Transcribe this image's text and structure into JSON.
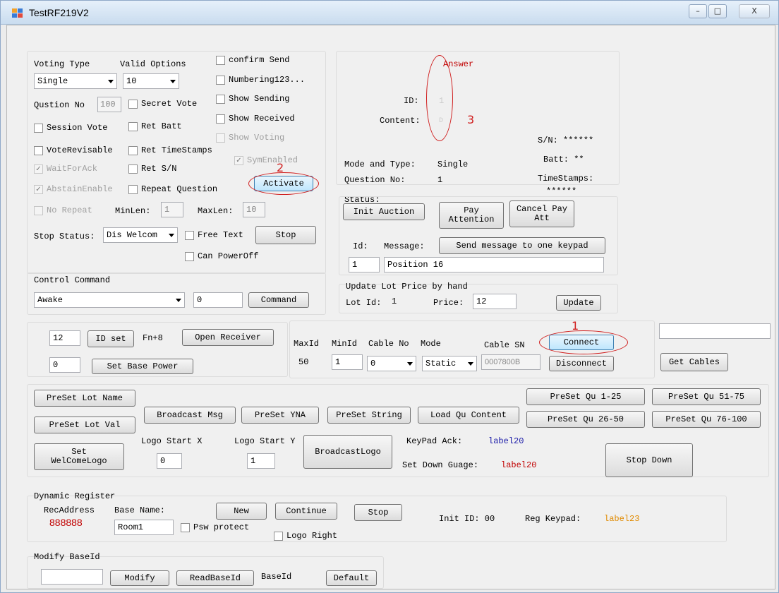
{
  "window": {
    "title": "TestRF219V2",
    "controls": [
      "–",
      "□",
      "X"
    ]
  },
  "voting": {
    "voting_type_label": "Voting Type",
    "voting_type_value": "Single",
    "valid_options_label": "Valid Options",
    "valid_options_value": "10",
    "confirm_send": "confirm Send",
    "numbering": "Numbering123...",
    "show_sending": "Show Sending",
    "show_received": "Show Received",
    "show_voting": "Show Voting",
    "qustion_no_label": "Qustion No",
    "qustion_no_value": "100",
    "secret_vote": "Secret Vote",
    "session_vote": "Session Vote",
    "ret_batt": "Ret Batt",
    "vote_revisable": "VoteRevisable",
    "ret_timestamps": "Ret TimeStamps",
    "sym_enabled": "SymEnabled",
    "wait_for_ack": "WaitForAck",
    "ret_sn": "Ret S/N",
    "abstain_enable": "AbstainEnable",
    "repeat_question": "Repeat Question",
    "activate": "Activate",
    "no_repeat": "No Repeat",
    "minlen_label": "MinLen:",
    "minlen_value": "1",
    "maxlen_label": "MaxLen:",
    "maxlen_value": "10",
    "stop_status_label": "Stop Status:",
    "stop_status_value": "Dis Welcom",
    "free_text": "Free Text",
    "stop": "Stop",
    "can_poweroff": "Can PowerOff"
  },
  "control": {
    "label": "Control Command",
    "combo_value": "Awake",
    "param_value": "0",
    "command_button": "Command"
  },
  "answer": {
    "answer_label": "Answer",
    "id_label": "ID:",
    "id_value": "1",
    "content_label": "Content:",
    "content_value": "D",
    "sn": "S/N: ******",
    "mode_label": "Mode and Type:",
    "mode_value": "Single",
    "batt": "Batt: **",
    "question_no_label": "Question No:",
    "question_no_value": "1",
    "timestamps_label": "TimeStamps:",
    "timestamps_value": "******",
    "status_label": "Status:"
  },
  "auction": {
    "init_auction": "Init Auction",
    "pay_attention": "Pay Attention",
    "cancel_pay_att": "Cancel Pay Att",
    "id_label": "Id:",
    "message_label": "Message:",
    "send_message": "Send message to one keypad",
    "id_value": "1",
    "message_value": "Position 16"
  },
  "update_lot": {
    "label": "Update Lot Price by hand",
    "lot_id_label": "Lot Id:",
    "lot_id_value": "1",
    "price_label": "Price:",
    "price_value": "12",
    "update_button": "Update"
  },
  "receiver": {
    "id_value": "12",
    "id_set": "ID set",
    "fn8": "Fn+8",
    "open_receiver": "Open Receiver",
    "power_value": "0",
    "set_base_power": "Set Base Power"
  },
  "cable": {
    "maxid_label": "MaxId",
    "minid_label": "MinId",
    "cable_no_label": "Cable No",
    "mode_label": "Mode",
    "cable_sn_label": "Cable SN",
    "maxid_value": "50",
    "minid_value": "1",
    "cable_no_value": "0",
    "mode_value": "Static",
    "cable_sn_value": "0007800B",
    "connect": "Connect",
    "disconnect": "Disconnect",
    "get_cables": "Get Cables",
    "top_field_value": ""
  },
  "preset": {
    "preset_lot_name": "PreSet Lot Name",
    "preset_lot_val": "PreSet Lot Val",
    "broadcast_msg": "Broadcast Msg",
    "preset_yna": "PreSet YNA",
    "preset_string": "PreSet String",
    "load_qu_content": "Load Qu Content",
    "preset_qu_1_25": "PreSet Qu 1-25",
    "preset_qu_26_50": "PreSet Qu 26-50",
    "preset_qu_51_75": "PreSet Qu 51-75",
    "preset_qu_76_100": "PreSet Qu 76-100",
    "set_welcome_logo": "Set WelComeLogo",
    "logo_start_x_label": "Logo Start X",
    "logo_start_x_value": "0",
    "logo_start_y_label": "Logo Start Y",
    "logo_start_y_value": "1",
    "broadcast_logo": "BroadcastLogo",
    "keypad_ack_label": "KeyPad Ack:",
    "keypad_ack_value": "label20",
    "set_down_guage_label": "Set Down Guage:",
    "set_down_guage_value": "label20",
    "stop_down": "Stop Down"
  },
  "dynamic": {
    "label": "Dynamic Register",
    "rec_address_label": "RecAddress",
    "rec_address_value": "888888",
    "base_name_label": "Base Name:",
    "base_name_value": "Room1",
    "new": "New",
    "continue": "Continue",
    "stop": "Stop",
    "psw_protect": "Psw protect",
    "logo_right": "Logo Right",
    "init_id": "Init ID: 00",
    "reg_keypad_label": "Reg Keypad:",
    "reg_keypad_value": "label23"
  },
  "modify": {
    "label": "Modify BaseId",
    "value": "",
    "modify": "Modify",
    "read": "ReadBaseId",
    "baseid_label": "BaseId",
    "default": "Default"
  },
  "annotations": {
    "one": "1",
    "two": "2",
    "three": "3"
  },
  "colors": {
    "accent_red": "#c00000",
    "label_blue": "#1a1aa8",
    "label_orange": "#e08a00",
    "annotation_red": "#d02020"
  }
}
